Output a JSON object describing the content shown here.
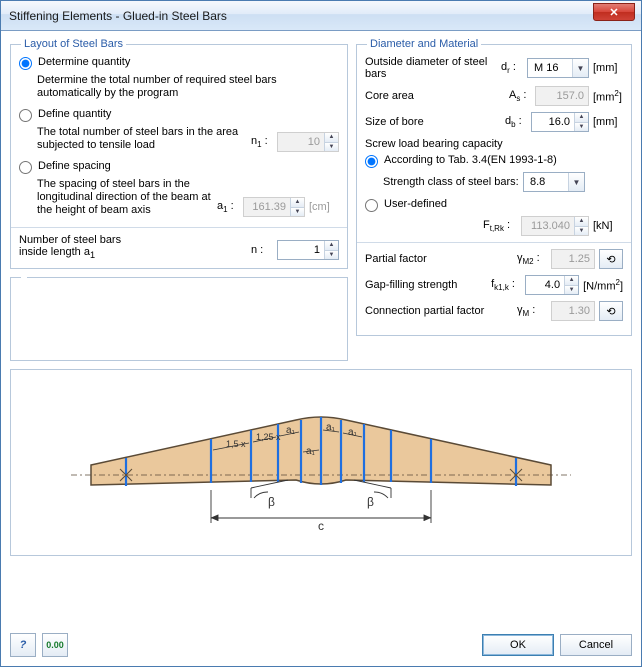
{
  "window": {
    "title": "Stiffening Elements - Glued-in Steel Bars"
  },
  "layout": {
    "legend": "Layout of Steel Bars",
    "determine": {
      "title": "Determine quantity",
      "desc": "Determine the total number of required steel bars automatically by the program"
    },
    "define_qty": {
      "title": "Define quantity",
      "desc": "The total number of steel bars in the area subjected to tensile load",
      "sym": "n 1 :",
      "val": "10"
    },
    "define_sp": {
      "title": "Define spacing",
      "desc": "The spacing of steel bars in the longitudinal direction of the beam at the height of beam axis",
      "sym": "a 1 :",
      "val": "161.39",
      "unit": "[cm]"
    },
    "num_bars": {
      "label1": "Number of steel bars",
      "label2": "inside length a 1",
      "sym": "n :",
      "val": "1"
    }
  },
  "diam": {
    "legend": "Diameter and Material",
    "outside": {
      "label": "Outside diameter of steel bars",
      "sym": "d r :",
      "val": "M 16",
      "unit": "[mm]"
    },
    "core": {
      "label": "Core area",
      "sym": "A s :",
      "val": "157.0",
      "unit": "[mm2]"
    },
    "bore": {
      "label": "Size of bore",
      "sym": "d b :",
      "val": "16.0",
      "unit": "[mm]"
    },
    "cap_label": "Screw load bearing capacity",
    "opt_tab": "According to Tab. 3.4(EN 1993-1-8)",
    "strength_class": {
      "label": "Strength class of steel bars:",
      "val": "8.8"
    },
    "opt_user": "User-defined",
    "ftrk": {
      "sym": "F t,Rk :",
      "val": "113.040",
      "unit": "[kN]"
    },
    "partial": {
      "label": "Partial factor",
      "sym": "γ M2 :",
      "val": "1.25"
    },
    "gap": {
      "label": "Gap-filling strength",
      "sym": "f k1,k :",
      "val": "4.0",
      "unit": "[N/mm2]"
    },
    "conn": {
      "label": "Connection partial factor",
      "sym": "γ M :",
      "val": "1.30"
    }
  },
  "buttons": {
    "ok": "OK",
    "cancel": "Cancel"
  },
  "diagram": {
    "a1": "a1",
    "mult15": "1,5 x",
    "mult125": "1,25 x",
    "beta": "β",
    "c": "c"
  }
}
